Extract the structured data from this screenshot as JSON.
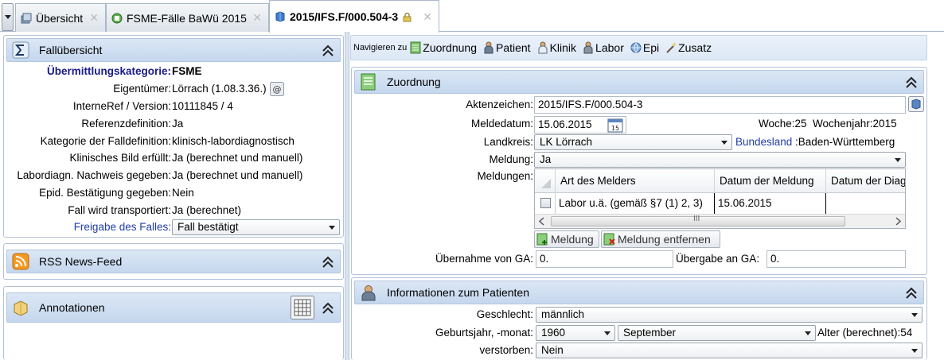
{
  "tabs": [
    {
      "label": "Übersicht",
      "icon": "overview-icon"
    },
    {
      "label": "FSME-Fälle BaWü 2015",
      "icon": "filter-list-icon"
    },
    {
      "label": "2015/IFS.F/000.504-3",
      "icon": "case-icon",
      "locked": true
    }
  ],
  "fall": {
    "title": "Fallübersicht",
    "rows": [
      {
        "label": "Übermittlungskategorie:",
        "value": "FSME"
      },
      {
        "label": "Eigentümer:",
        "value": "Lörrach (1.08.3.36.)"
      },
      {
        "label": "InterneRef / Version:",
        "value": "10111845  /  4"
      },
      {
        "label": "Referenzdefinition:",
        "value": "Ja"
      },
      {
        "label": "Kategorie der Falldefinition:",
        "value": "klinisch-labordiagnostisch"
      },
      {
        "label": "Klinisches Bild erfüllt:",
        "value": "Ja (berechnet und manuell)"
      },
      {
        "label": "Labordiagn. Nachweis gegeben:",
        "value": "Ja (berechnet und manuell)"
      },
      {
        "label": "Epid. Bestätigung gegeben:",
        "value": "Nein"
      },
      {
        "label": "Fall wird transportiert:",
        "value": "Ja (berechnet)"
      }
    ],
    "freigabe_label": "Freigabe des Falles:",
    "freigabe_value": "Fall bestätigt"
  },
  "rss": {
    "title": "RSS News-Feed"
  },
  "annot": {
    "title": "Annotationen"
  },
  "nav": {
    "prefix": "Navigieren zu",
    "items": [
      "Zuordnung",
      "Patient",
      "Klinik",
      "Labor",
      "Epi",
      "Zusatz"
    ]
  },
  "zuordnung": {
    "title": "Zuordnung",
    "aktenzeichen_label": "Aktenzeichen:",
    "aktenzeichen_value": "2015/IFS.F/000.504-3",
    "meldedatum_label": "Meldedatum:",
    "meldedatum_value": "15.06.2015",
    "woche_label": "Woche:",
    "woche_value": "25",
    "wochenjahr_label": "Wochenjahr:",
    "wochenjahr_value": "2015",
    "landkreis_label": "Landkreis:",
    "landkreis_value": "LK Lörrach",
    "bundesland_label": "Bundesland",
    "bundesland_value": ":Baden-Württemberg",
    "meldung_label": "Meldung:",
    "meldung_value": "Ja",
    "meldungen_label": "Meldungen:",
    "table": {
      "columns": [
        "Art des Melders",
        "Datum der Meldung",
        "Datum der Diag"
      ],
      "rows": [
        [
          "Labor u.ä. (gemäß §7 (1) 2, 3)",
          "15.06.2015",
          ""
        ]
      ]
    },
    "add_button": "Meldung",
    "remove_button": "Meldung entfernen",
    "uebernahme_label": "Übernahme von GA:",
    "uebernahme_value": "0.",
    "uebergabe_label": "Übergabe an GA:",
    "uebergabe_value": "0."
  },
  "patient": {
    "title": "Informationen zum Patienten",
    "geschlecht_label": "Geschlecht:",
    "geschlecht_value": "männlich",
    "geburt_label": "Geburtsjahr, -monat:",
    "geburtsjahr_value": "1960",
    "geburtsmonat_value": "September",
    "alter_label": "Alter (berechnet):",
    "alter_value": "54",
    "verstorben_label": "verstorben:",
    "verstorben_value": "Nein"
  }
}
